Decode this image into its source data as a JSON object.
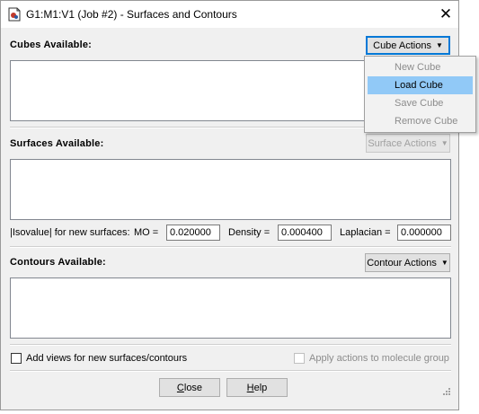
{
  "window": {
    "title": "G1:M1:V1 (Job #2) - Surfaces and Contours",
    "close_glyph": "✕"
  },
  "cubes": {
    "heading": "Cubes Available:",
    "actions_label": "Cube Actions",
    "menu": [
      {
        "label": "New Cube",
        "enabled": false
      },
      {
        "label": "Load Cube",
        "enabled": true,
        "highlighted": true
      },
      {
        "label": "Save Cube",
        "enabled": false
      },
      {
        "label": "Remove Cube",
        "enabled": false
      }
    ]
  },
  "surfaces": {
    "heading": "Surfaces Available:",
    "actions_label": "Surface Actions",
    "actions_enabled": false
  },
  "isovalue": {
    "label": "|Isovalue| for new surfaces:",
    "mo_label": "MO =",
    "mo_value": "0.020000",
    "density_label": "Density =",
    "density_value": "0.000400",
    "laplacian_label": "Laplacian =",
    "laplacian_value": "0.000000"
  },
  "contours": {
    "heading": "Contours Available:",
    "actions_label": "Contour Actions"
  },
  "options": {
    "add_views_label": "Add views for new surfaces/contours",
    "add_views_checked": false,
    "apply_group_label": "Apply actions to molecule group",
    "apply_group_checked": false,
    "apply_group_enabled": false
  },
  "buttons": {
    "close_label": "Close",
    "close_mnemonic": "C",
    "close_rest": "lose",
    "help_label": "Help",
    "help_mnemonic": "H",
    "help_rest": "elp"
  },
  "icons": {
    "app": "gaussview-document-icon",
    "dropdown": "triangle-down",
    "resize": "size-grip"
  }
}
